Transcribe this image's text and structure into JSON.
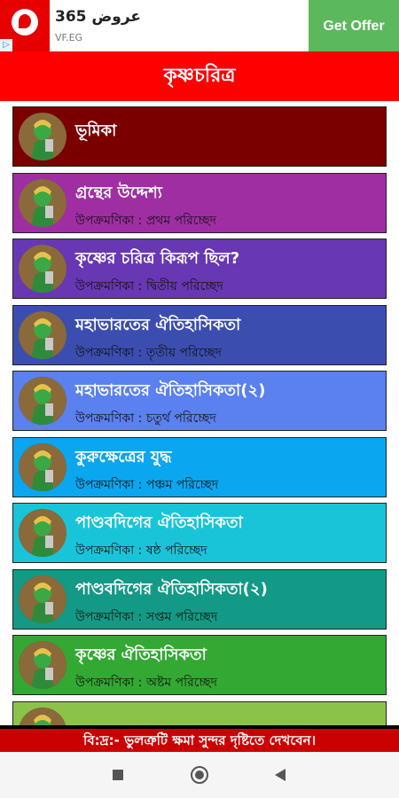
{
  "ad": {
    "title": "365 عروض",
    "subtitle": "VF.EG",
    "cta": "Get Offer",
    "adchoice": "▷"
  },
  "appbar": {
    "title": "কৃষ্ণচরিত্র"
  },
  "colors": {
    "ad_red": "#e60000",
    "appbar": "#ff0000",
    "cta": "#5cb85c"
  },
  "items": [
    {
      "title": "ভূমিকা",
      "subtitle": "",
      "color": "#7a0000"
    },
    {
      "title": "গ্রন্থের উদ্দেশ্য",
      "subtitle": "উপক্রমণিকা : প্রথম পরিচ্ছেদ",
      "color": "#a02ea3"
    },
    {
      "title": "কৃষ্ণের চরিত্র কিরূপ ছিল?",
      "subtitle": "উপক্রমণিকা : দ্বিতীয় পরিচ্ছেদ",
      "color": "#6837b3"
    },
    {
      "title": "মহাভারতের ঐতিহাসিকতা",
      "subtitle": "উপক্রমণিকা : তৃতীয় পরিচ্ছেদ",
      "color": "#3b4eb0"
    },
    {
      "title": "মহাভারতের ঐতিহাসিকতা(২)",
      "subtitle": "উপক্রমণিকা : চতুর্থ পরিচ্ছেদ",
      "color": "#5b80ef"
    },
    {
      "title": "কুরুক্ষেত্রের যুদ্ধ",
      "subtitle": "উপক্রমণিকা : পঞ্চম পরিচ্ছেদ",
      "color": "#0aa6ef"
    },
    {
      "title": "পাণ্ডবদিগের ঐতিহাসিকতা",
      "subtitle": "উপক্রমণিকা : ষষ্ঠ পরিচ্ছেদ",
      "color": "#19c4d9"
    },
    {
      "title": "পাণ্ডবদিগের ঐতিহাসিকতা(২)",
      "subtitle": "উপক্রমণিকা : সপ্তম পরিচ্ছেদ",
      "color": "#129a86"
    },
    {
      "title": "কৃষ্ণের ঐতিহাসিকতা",
      "subtitle": "উপক্রমণিকা : অষ্টম পরিচ্ছেদ",
      "color": "#33a833"
    },
    {
      "title": "",
      "subtitle": "",
      "color": "#8bc34a"
    }
  ],
  "notice": "বি:দ্র:- ভুলত্রুটি ক্ষমা সুন্দর দৃষ্টিতে দেখবেন।"
}
